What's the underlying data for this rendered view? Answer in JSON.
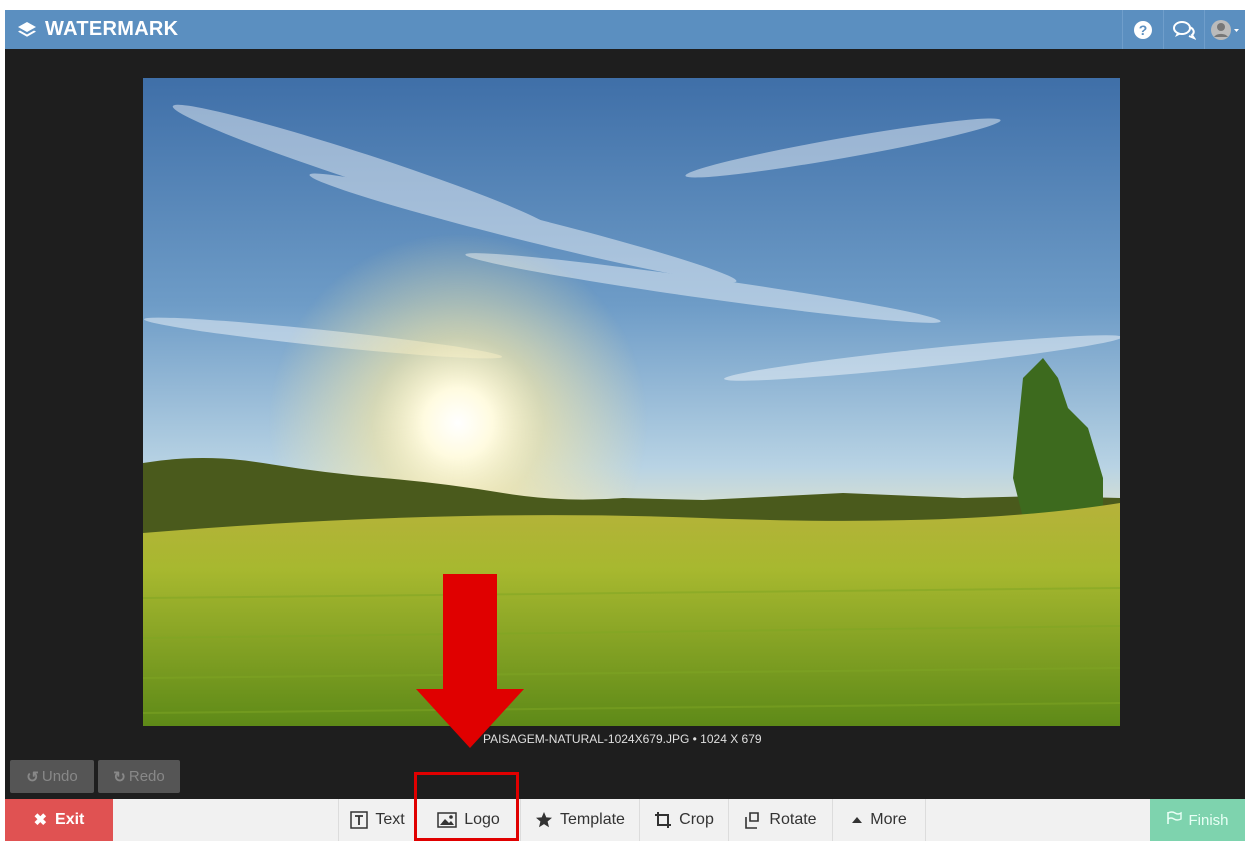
{
  "app": {
    "brand": "WATERMARK",
    "header_icons": [
      "help-icon",
      "chat-icon",
      "user-avatar-icon"
    ],
    "accent_color": "#5b8fc0"
  },
  "image": {
    "caption": "PAISAGEM-NATURAL-1024X679.JPG • 1024 X 679"
  },
  "history": {
    "undo": "Undo",
    "redo": "Redo"
  },
  "toolbar": {
    "exit": "Exit",
    "finish": "Finish",
    "tools": [
      {
        "label": "Text",
        "icon": "text-icon"
      },
      {
        "label": "Logo",
        "icon": "image-icon"
      },
      {
        "label": "Template",
        "icon": "star-icon"
      },
      {
        "label": "Crop",
        "icon": "crop-icon"
      },
      {
        "label": "Rotate",
        "icon": "rotate-icon"
      },
      {
        "label": "More",
        "icon": "caret-up-icon"
      }
    ],
    "exit_color": "#e05252",
    "finish_color": "#7ed3ae"
  },
  "annotation": {
    "highlight_color": "#e00000",
    "highlighted_tool": "Logo"
  }
}
